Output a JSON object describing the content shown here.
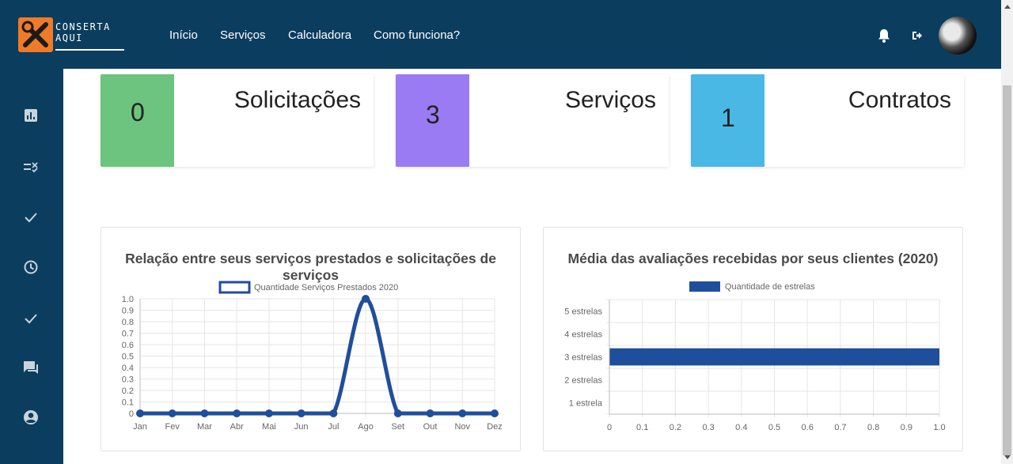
{
  "navbar": {
    "brand_line1": "CONSERTA",
    "brand_line2": "AQUI",
    "links": [
      "Início",
      "Serviços",
      "Calculadora",
      "Como funciona?"
    ],
    "bg_color": "#0b3d5e",
    "accent_color": "#f07a27"
  },
  "sidebar": {
    "icons": [
      "chart-icon",
      "checklist-icon",
      "check-icon",
      "clock-icon",
      "check-icon",
      "chat-icon",
      "account-icon"
    ]
  },
  "cards": [
    {
      "count": "0",
      "label": "Solicitações",
      "color": "#6cc47e"
    },
    {
      "count": "3",
      "label": "Serviços",
      "color": "#9b7bf4"
    },
    {
      "count": "1",
      "label": "Contratos",
      "color": "#4ab8e4"
    }
  ],
  "charts": {
    "line_title": "Relação entre seus serviços prestados e solicitações de serviços",
    "bar_title": "Média das avaliações recebidas por seus clientes (2020)"
  },
  "chart_data": [
    {
      "type": "line",
      "title": "Relação entre seus serviços prestados e solicitações de serviços",
      "categories": [
        "Jan",
        "Fev",
        "Mar",
        "Abr",
        "Mai",
        "Jun",
        "Jul",
        "Ago",
        "Set",
        "Out",
        "Nov",
        "Dez"
      ],
      "series": [
        {
          "name": "Quantidade Serviços Prestados 2020",
          "values": [
            0,
            0,
            0,
            0,
            0,
            0,
            0,
            1,
            0,
            0,
            0,
            0
          ]
        }
      ],
      "yticks": [
        "1.0",
        "0.9",
        "0.8",
        "0.7",
        "0.6",
        "0.5",
        "0.4",
        "0.3",
        "0.2",
        "0.1",
        "0"
      ],
      "ylim": [
        0,
        1
      ],
      "grid": true,
      "legend": "top-center",
      "color": "#1f4e9c"
    },
    {
      "type": "bar",
      "orientation": "horizontal",
      "title": "Média das avaliações recebidas por seus clientes (2020)",
      "categories": [
        "5 estrelas",
        "4 estrelas",
        "3 estrelas",
        "2 estrelas",
        "1 estrela"
      ],
      "series": [
        {
          "name": "Quantidade de estrelas",
          "values": [
            0,
            0,
            1,
            0,
            0
          ]
        }
      ],
      "xticks": [
        "0",
        "0.1",
        "0.2",
        "0.3",
        "0.4",
        "0.5",
        "0.6",
        "0.7",
        "0.8",
        "0.9",
        "1.0"
      ],
      "xlim": [
        0,
        1
      ],
      "grid": true,
      "legend": "top-center",
      "color": "#1f4e9c"
    }
  ]
}
